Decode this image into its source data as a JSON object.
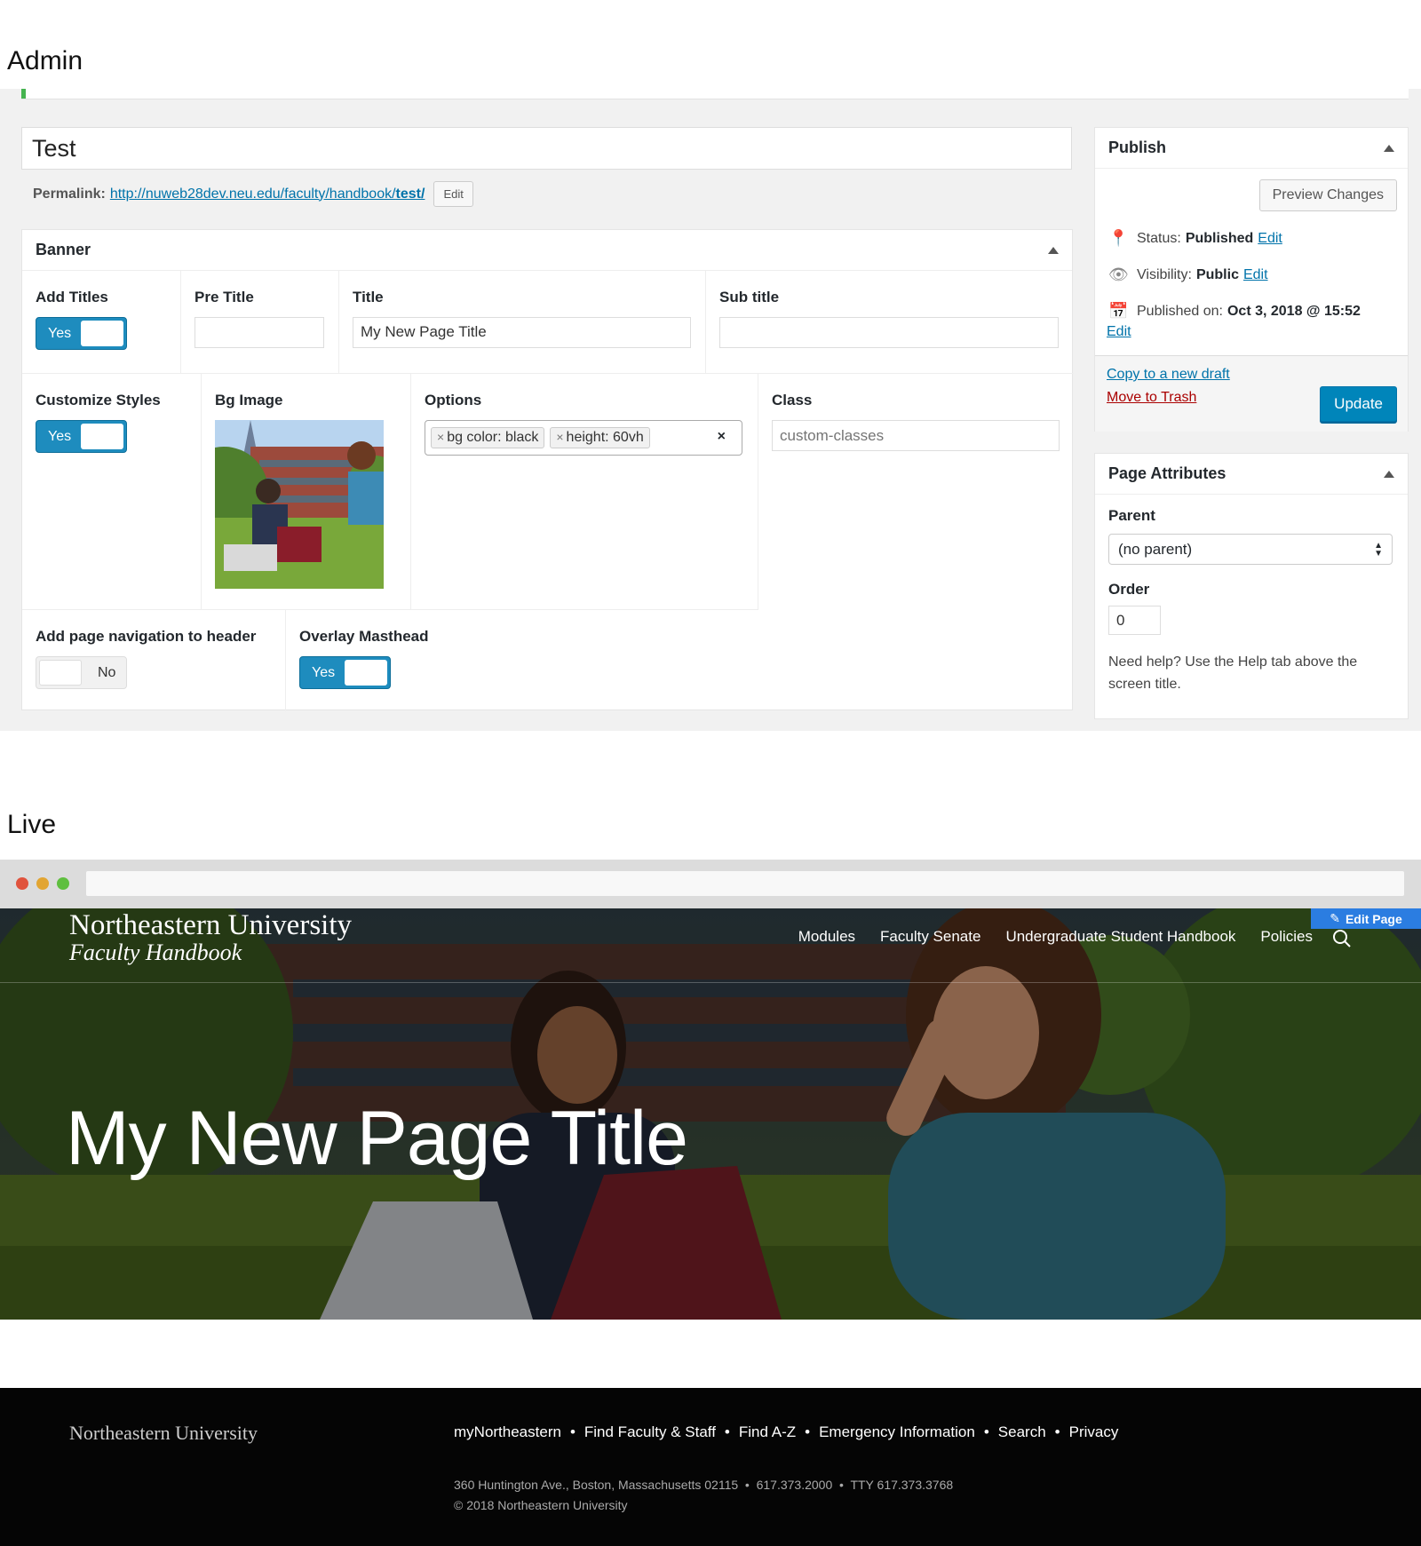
{
  "admin": {
    "heading": "Admin",
    "post_title": "Test",
    "permalink_label": "Permalink:",
    "permalink_url_base": "http://nuweb28dev.neu.edu/faculty/handbook/",
    "permalink_url_slug": "test/",
    "permalink_edit": "Edit",
    "banner": {
      "header": "Banner",
      "add_titles": {
        "label": "Add Titles",
        "value": "Yes"
      },
      "pre_title": {
        "label": "Pre Title",
        "value": ""
      },
      "title": {
        "label": "Title",
        "value": "My New Page Title"
      },
      "sub_title": {
        "label": "Sub title",
        "value": ""
      },
      "customize_styles": {
        "label": "Customize Styles",
        "value": "Yes"
      },
      "bg_image": {
        "label": "Bg Image"
      },
      "options": {
        "label": "Options",
        "tags": [
          "bg color: black",
          "height: 60vh"
        ],
        "clear": "×"
      },
      "class": {
        "label": "Class",
        "placeholder": "custom-classes"
      },
      "page_nav": {
        "label": "Add page navigation to header",
        "value": "No"
      },
      "overlay": {
        "label": "Overlay Masthead",
        "value": "Yes"
      }
    },
    "publish": {
      "header": "Publish",
      "preview": "Preview Changes",
      "status_label": "Status:",
      "status_value": "Published",
      "visibility_label": "Visibility:",
      "visibility_value": "Public",
      "published_label": "Published on:",
      "published_value": "Oct 3, 2018 @ 15:52",
      "edit": "Edit",
      "copy": "Copy to a new draft",
      "trash": "Move to Trash",
      "update": "Update"
    },
    "attributes": {
      "header": "Page Attributes",
      "parent_label": "Parent",
      "parent_value": "(no parent)",
      "order_label": "Order",
      "order_value": "0",
      "help": "Need help? Use the Help tab above the screen title."
    }
  },
  "live": {
    "heading": "Live",
    "brand_line1": "Northeastern University",
    "brand_line2": "Faculty Handbook",
    "edit_page": "Edit Page",
    "nav": [
      "Modules",
      "Faculty Senate",
      "Undergraduate Student Handbook",
      "Policies"
    ],
    "hero_title": "My New Page Title",
    "footer": {
      "brand": "Northeastern University",
      "links": [
        "myNortheastern",
        "Find Faculty & Staff",
        "Find A-Z",
        "Emergency Information",
        "Search",
        "Privacy"
      ],
      "address": "360 Huntington Ave., Boston, Massachusetts 02115  •  617.373.2000  •  TTY 617.373.3768",
      "copyright": "© 2018 Northeastern University"
    }
  },
  "colors": {
    "accent": "#0085ba",
    "trash": "#a00",
    "green": "#46b450",
    "edit_page_bg": "#2b7de1"
  }
}
